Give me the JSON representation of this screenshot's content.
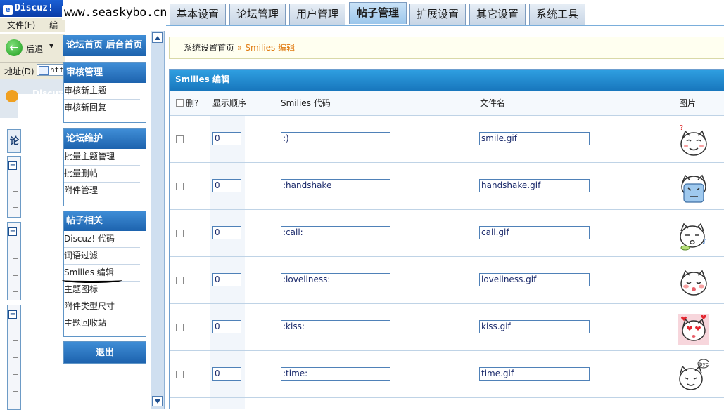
{
  "browser": {
    "title": "Discuz!",
    "menu": [
      "文件(F)",
      "编辑"
    ],
    "back_label": "后退",
    "address_label": "地址(D)",
    "address_value": "htt",
    "header_text": "Discuz",
    "watermark": "www.seaskybo.cn"
  },
  "tabs": [
    {
      "label": "基本设置",
      "active": false
    },
    {
      "label": "论坛管理",
      "active": false
    },
    {
      "label": "用户管理",
      "active": false
    },
    {
      "label": "帖子管理",
      "active": true
    },
    {
      "label": "扩展设置",
      "active": false
    },
    {
      "label": "其它设置",
      "active": false
    },
    {
      "label": "系统工具",
      "active": false
    }
  ],
  "sidebar": {
    "top_links": "论坛首页 后台首页",
    "tree_label": "论",
    "groups": [
      {
        "title": "审核管理",
        "items": [
          "审核新主题",
          "审核新回复"
        ]
      },
      {
        "title": "论坛维护",
        "items": [
          "批量主题管理",
          "批量删帖",
          "附件管理"
        ]
      },
      {
        "title": "帖子相关",
        "items": [
          "Discuz! 代码",
          "词语过滤",
          "Smilies 编辑",
          "主题图标",
          "附件类型尺寸",
          "主题回收站"
        ]
      }
    ],
    "logout": "退出"
  },
  "breadcrumb": {
    "home": "系统设置首页",
    "sep": "»",
    "current": "Smilies 编辑"
  },
  "panel": {
    "title": "Smilies 编辑",
    "columns": {
      "delete": "删?",
      "order": "显示顺序",
      "code": "Smilies 代码",
      "file": "文件名",
      "image": "图片"
    },
    "rows": [
      {
        "order": "0",
        "code": ":)",
        "file": "smile.gif",
        "icon": "smile-face"
      },
      {
        "order": "0",
        "code": ":handshake",
        "file": "handshake.gif",
        "icon": "handshake-face"
      },
      {
        "order": "0",
        "code": ":call:",
        "file": "call.gif",
        "icon": "call-face"
      },
      {
        "order": "0",
        "code": ":loveliness:",
        "file": "loveliness.gif",
        "icon": "loveliness-face"
      },
      {
        "order": "0",
        "code": ":kiss:",
        "file": "kiss.gif",
        "icon": "kiss-face"
      },
      {
        "order": "0",
        "code": ":time:",
        "file": "time.gif",
        "icon": "time-face",
        "label": "bye"
      }
    ]
  }
}
